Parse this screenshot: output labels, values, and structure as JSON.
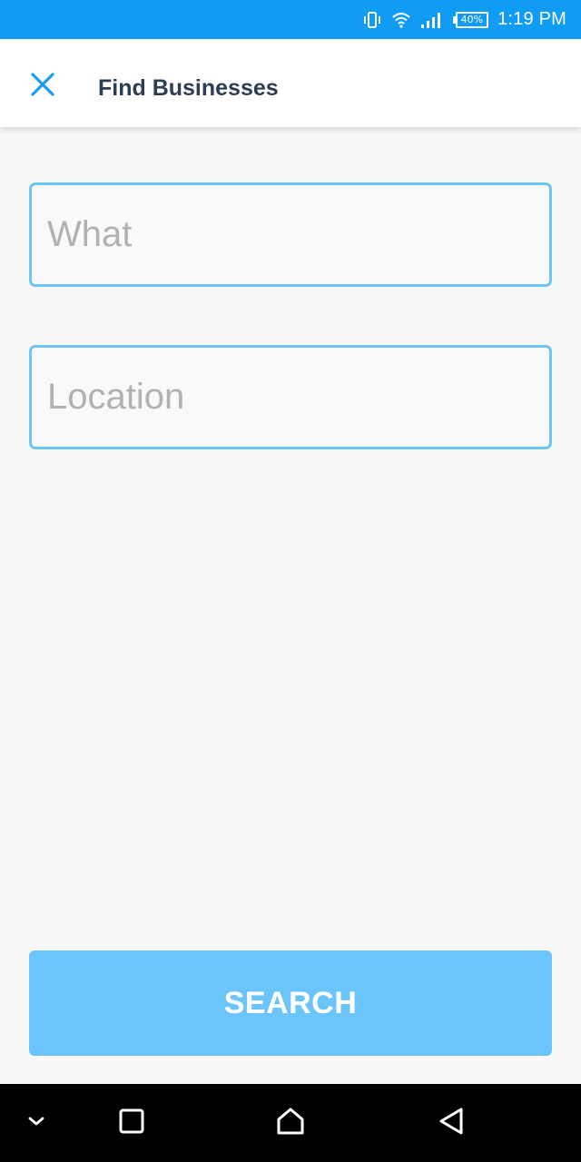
{
  "status_bar": {
    "icons": [
      "vibrate-icon",
      "wifi-icon",
      "signal-icon"
    ],
    "battery_label": "40%",
    "time": "1:19 PM",
    "background_color": "#109bf4"
  },
  "app_bar": {
    "close_icon": "close-icon",
    "title": "Find Businesses",
    "accent_color": "#1a9cf0"
  },
  "form": {
    "what": {
      "placeholder": "What",
      "value": ""
    },
    "location": {
      "placeholder": "Location",
      "value": ""
    },
    "border_color": "#6ec6f7"
  },
  "search_button": {
    "label": "SEARCH",
    "color": "#6cc5fa"
  },
  "nav_bar": {
    "items": [
      "chevron-down-icon",
      "recent-apps-icon",
      "home-icon",
      "back-icon"
    ]
  }
}
